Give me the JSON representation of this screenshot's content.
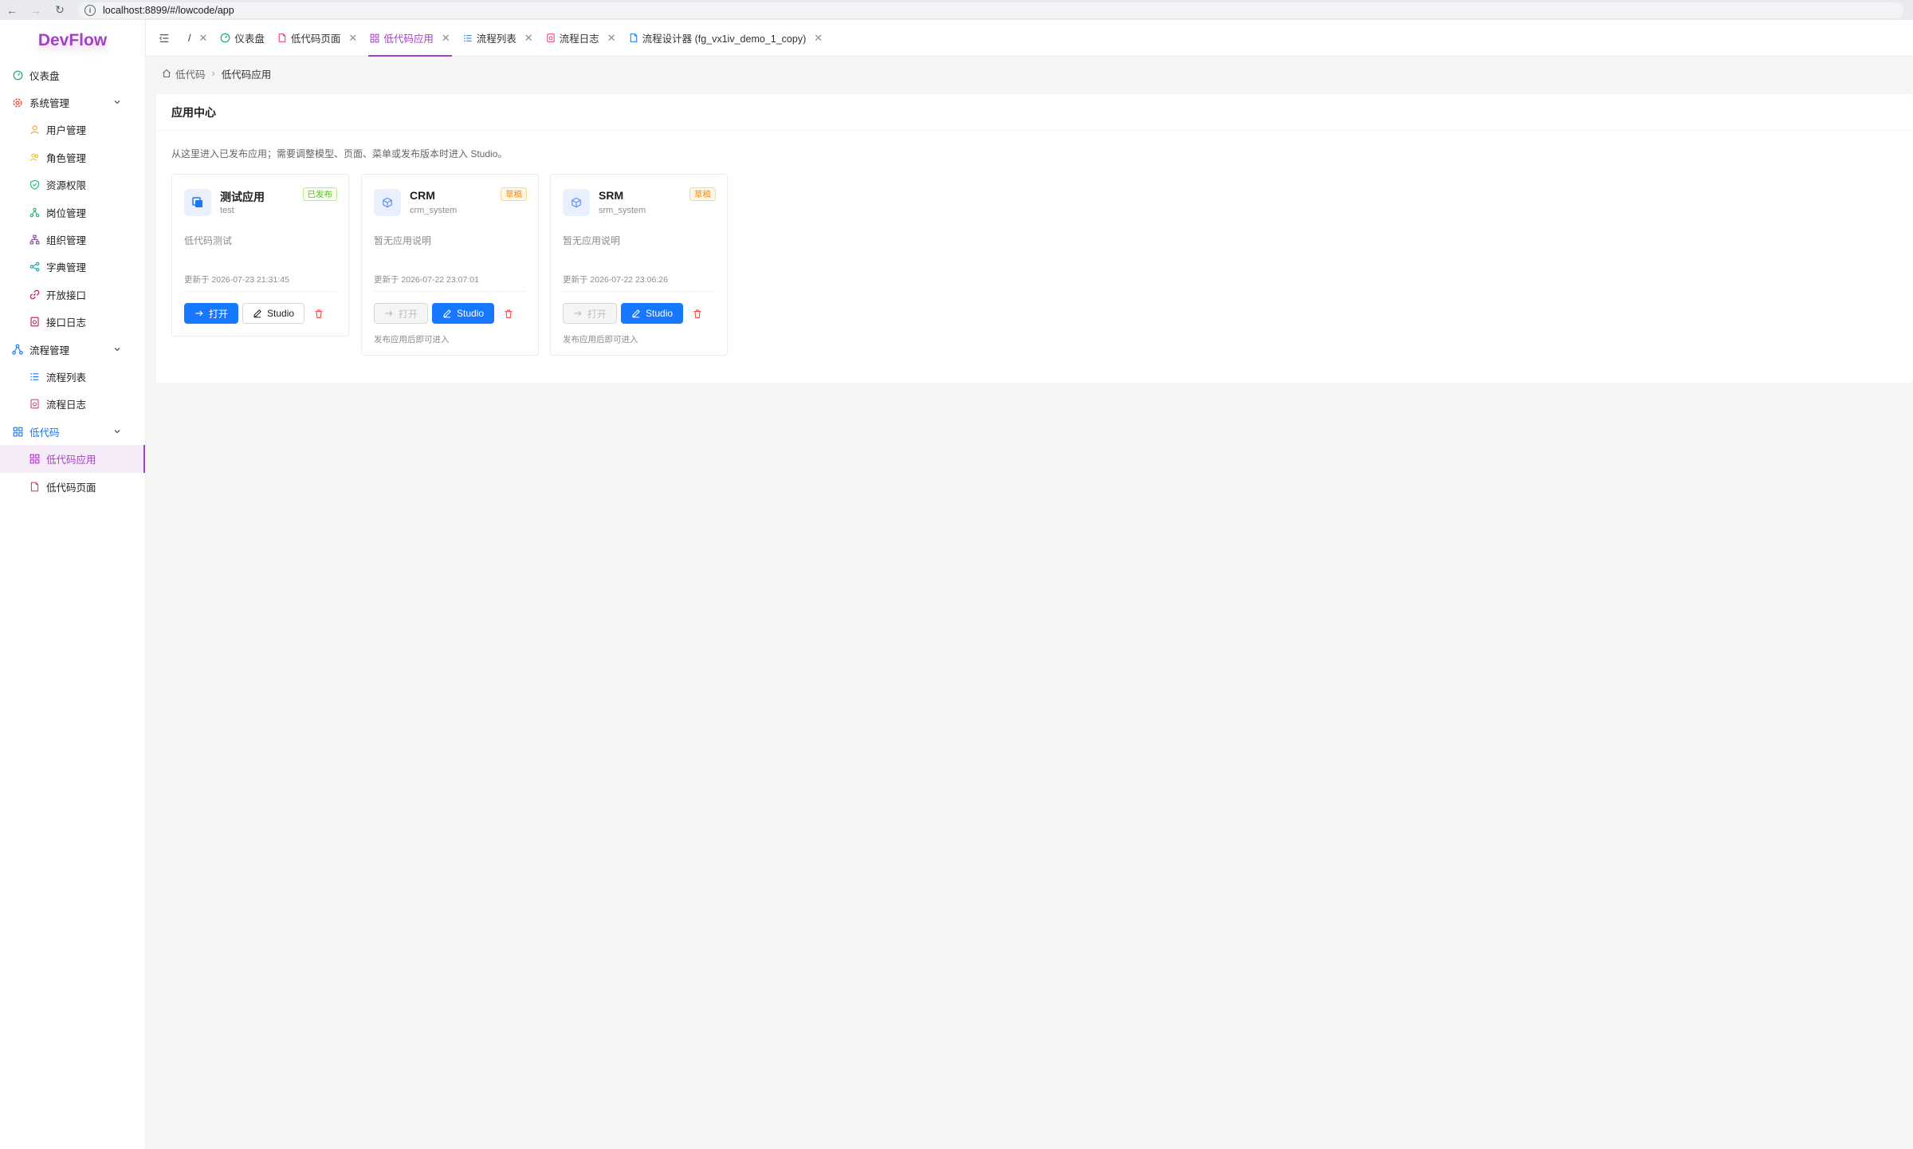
{
  "browser": {
    "url": "localhost:8899/#/lowcode/app"
  },
  "sidebar": {
    "logo": "DevFlow",
    "items": [
      {
        "label": "仪表盘",
        "icon": "dashboard-icon"
      },
      {
        "label": "系统管理",
        "icon": "gear-icon"
      },
      {
        "label": "用户管理",
        "icon": "user-icon"
      },
      {
        "label": "角色管理",
        "icon": "role-icon"
      },
      {
        "label": "资源权限",
        "icon": "shield-icon"
      },
      {
        "label": "岗位管理",
        "icon": "position-icon"
      },
      {
        "label": "组织管理",
        "icon": "org-icon"
      },
      {
        "label": "字典管理",
        "icon": "dictionary-icon"
      },
      {
        "label": "开放接口",
        "icon": "link-icon"
      },
      {
        "label": "接口日志",
        "icon": "log-icon"
      },
      {
        "label": "流程管理",
        "icon": "workflow-icon"
      },
      {
        "label": "流程列表",
        "icon": "list-icon"
      },
      {
        "label": "流程日志",
        "icon": "log-icon"
      },
      {
        "label": "低代码",
        "icon": "grid-icon"
      },
      {
        "label": "低代码应用",
        "icon": "grid-icon"
      },
      {
        "label": "低代码页面",
        "icon": "page-icon"
      }
    ]
  },
  "tabs": [
    {
      "label": "/",
      "icon": ""
    },
    {
      "label": "仪表盘",
      "icon": "dashboard-icon"
    },
    {
      "label": "低代码页面",
      "icon": "page-icon"
    },
    {
      "label": "低代码应用",
      "icon": "grid-icon"
    },
    {
      "label": "流程列表",
      "icon": "list-icon"
    },
    {
      "label": "流程日志",
      "icon": "log-icon"
    },
    {
      "label": "流程设计器 (fg_vx1iv_demo_1_copy)",
      "icon": "page-icon"
    }
  ],
  "breadcrumb": {
    "root": "低代码",
    "current": "低代码应用"
  },
  "panel": {
    "title": "应用中心",
    "description": "从这里进入已发布应用；需要调整模型、页面、菜单或发布版本时进入 Studio。"
  },
  "apps": [
    {
      "name": "测试应用",
      "code": "test",
      "status": "已发布",
      "description": "低代码测试",
      "updated": "更新于 2026-07-23 21:31:45",
      "open_label": "打开",
      "studio_label": "Studio",
      "hint": ""
    },
    {
      "name": "CRM",
      "code": "crm_system",
      "status": "草稿",
      "description": "暂无应用说明",
      "updated": "更新于 2026-07-22 23:07:01",
      "open_label": "打开",
      "studio_label": "Studio",
      "hint": "发布应用后即可进入"
    },
    {
      "name": "SRM",
      "code": "srm_system",
      "status": "草稿",
      "description": "暂无应用说明",
      "updated": "更新于 2026-07-22 23:06:26",
      "open_label": "打开",
      "studio_label": "Studio",
      "hint": "发布应用后即可进入"
    }
  ],
  "colors": {
    "brand": "#a341c4",
    "primary": "#1677ff",
    "published": "#52c41a",
    "draft": "#fa8c16",
    "danger": "#ff4d4f"
  }
}
